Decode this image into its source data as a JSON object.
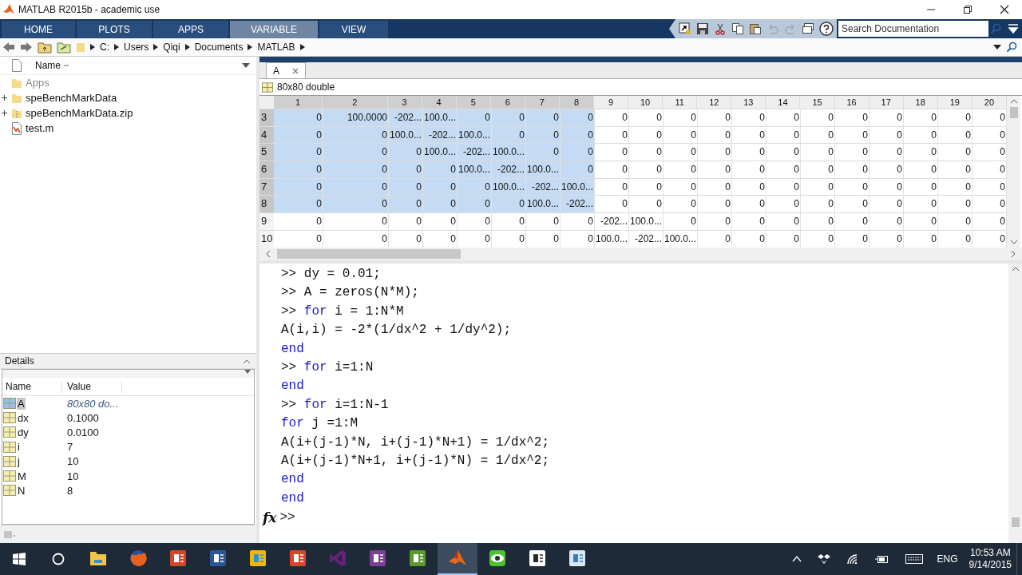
{
  "window": {
    "title": "MATLAB R2015b - academic use"
  },
  "ribbon": {
    "tabs": [
      {
        "label": "HOME",
        "selected": false
      },
      {
        "label": "PLOTS",
        "selected": false
      },
      {
        "label": "APPS",
        "selected": false
      },
      {
        "label": "VARIABLE",
        "selected": true
      },
      {
        "label": "VIEW",
        "selected": false
      }
    ],
    "search": {
      "placeholder": "Search Documentation"
    }
  },
  "address_bar": {
    "path": [
      "C:",
      "Users",
      "Qiqi",
      "Documents",
      "MATLAB"
    ]
  },
  "current_folder": {
    "header": "Name",
    "items": [
      {
        "name": "Apps",
        "kind": "folder",
        "expandable": false,
        "dimmed": true
      },
      {
        "name": "speBenchMarkData",
        "kind": "folder",
        "expandable": true,
        "dimmed": false
      },
      {
        "name": "speBenchMarkData.zip",
        "kind": "zip",
        "expandable": true,
        "dimmed": false
      },
      {
        "name": "test.m",
        "kind": "mfile",
        "expandable": false,
        "dimmed": false
      }
    ]
  },
  "details": {
    "title": "Details"
  },
  "workspace": {
    "columns": [
      "Name",
      "Value"
    ],
    "rows": [
      {
        "name": "A",
        "value": "80x80 do...",
        "kind": "matrix",
        "selected": true
      },
      {
        "name": "dx",
        "value": "0.1000",
        "kind": "scalar",
        "selected": false
      },
      {
        "name": "dy",
        "value": "0.0100",
        "kind": "scalar",
        "selected": false
      },
      {
        "name": "i",
        "value": "7",
        "kind": "scalar",
        "selected": false
      },
      {
        "name": "j",
        "value": "10",
        "kind": "scalar",
        "selected": false
      },
      {
        "name": "M",
        "value": "10",
        "kind": "scalar",
        "selected": false
      },
      {
        "name": "N",
        "value": "8",
        "kind": "scalar",
        "selected": false
      }
    ]
  },
  "variable_editor": {
    "tab": "A",
    "info": "80x80 double",
    "columns": [
      {
        "label": "1",
        "selected": true
      },
      {
        "label": "2",
        "selected": true
      },
      {
        "label": "3",
        "selected": true
      },
      {
        "label": "4",
        "selected": true
      },
      {
        "label": "5",
        "selected": true
      },
      {
        "label": "6",
        "selected": true
      },
      {
        "label": "7",
        "selected": true
      },
      {
        "label": "8",
        "selected": true
      },
      {
        "label": "9",
        "selected": false
      },
      {
        "label": "10",
        "selected": false
      },
      {
        "label": "11",
        "selected": false
      },
      {
        "label": "12",
        "selected": false
      },
      {
        "label": "13",
        "selected": false
      },
      {
        "label": "14",
        "selected": false
      },
      {
        "label": "15",
        "selected": false
      },
      {
        "label": "16",
        "selected": false
      },
      {
        "label": "17",
        "selected": false
      },
      {
        "label": "18",
        "selected": false
      },
      {
        "label": "19",
        "selected": false
      },
      {
        "label": "20",
        "selected": false
      }
    ],
    "rows": [
      {
        "label": "3",
        "selected": true,
        "cells": [
          "0",
          "100.0000",
          "-202...",
          "100.0...",
          "0",
          "0",
          "0",
          "0",
          "0",
          "0",
          "0",
          "0",
          "0",
          "0",
          "0",
          "0",
          "0",
          "0",
          "0",
          "0"
        ]
      },
      {
        "label": "4",
        "selected": true,
        "cells": [
          "0",
          "0",
          "100.0...",
          "-202...",
          "100.0...",
          "0",
          "0",
          "0",
          "0",
          "0",
          "0",
          "0",
          "0",
          "0",
          "0",
          "0",
          "0",
          "0",
          "0",
          "0"
        ]
      },
      {
        "label": "5",
        "selected": true,
        "cells": [
          "0",
          "0",
          "0",
          "100.0...",
          "-202...",
          "100.0...",
          "0",
          "0",
          "0",
          "0",
          "0",
          "0",
          "0",
          "0",
          "0",
          "0",
          "0",
          "0",
          "0",
          "0"
        ]
      },
      {
        "label": "6",
        "selected": true,
        "cells": [
          "0",
          "0",
          "0",
          "0",
          "100.0...",
          "-202...",
          "100.0...",
          "0",
          "0",
          "0",
          "0",
          "0",
          "0",
          "0",
          "0",
          "0",
          "0",
          "0",
          "0",
          "0"
        ]
      },
      {
        "label": "7",
        "selected": true,
        "cells": [
          "0",
          "0",
          "0",
          "0",
          "0",
          "100.0...",
          "-202...",
          "100.0...",
          "0",
          "0",
          "0",
          "0",
          "0",
          "0",
          "0",
          "0",
          "0",
          "0",
          "0",
          "0"
        ]
      },
      {
        "label": "8",
        "selected": true,
        "cells": [
          "0",
          "0",
          "0",
          "0",
          "0",
          "0",
          "100.0...",
          "-202...",
          "0",
          "0",
          "0",
          "0",
          "0",
          "0",
          "0",
          "0",
          "0",
          "0",
          "0",
          "0"
        ]
      },
      {
        "label": "9",
        "selected": false,
        "cells": [
          "0",
          "0",
          "0",
          "0",
          "0",
          "0",
          "0",
          "0",
          "-202...",
          "100.0...",
          "0",
          "0",
          "0",
          "0",
          "0",
          "0",
          "0",
          "0",
          "0",
          "0"
        ]
      },
      {
        "label": "10",
        "selected": false,
        "cells": [
          "0",
          "0",
          "0",
          "0",
          "0",
          "0",
          "0",
          "0",
          "100.0...",
          "-202...",
          "100.0...",
          "0",
          "0",
          "0",
          "0",
          "0",
          "0",
          "0",
          "0",
          "0"
        ]
      }
    ]
  },
  "command_window": {
    "lines": [
      [
        {
          "text": ">> dy = 0.01;",
          "kind": "code"
        }
      ],
      [
        {
          "text": ">> A = zeros(N*M);",
          "kind": "code"
        }
      ],
      [
        {
          "text": ">> ",
          "kind": "code"
        },
        {
          "text": "for",
          "kind": "keyword"
        },
        {
          "text": " i = 1:N*M",
          "kind": "code"
        }
      ],
      [
        {
          "text": "A(i,i) = -2*(1/dx^2 + 1/dy^2);",
          "kind": "code"
        }
      ],
      [
        {
          "text": "end",
          "kind": "keyword"
        }
      ],
      [
        {
          "text": ">> ",
          "kind": "code"
        },
        {
          "text": "for",
          "kind": "keyword"
        },
        {
          "text": " i=1:N",
          "kind": "code"
        }
      ],
      [
        {
          "text": "end",
          "kind": "keyword"
        }
      ],
      [
        {
          "text": ">> ",
          "kind": "code"
        },
        {
          "text": "for",
          "kind": "keyword"
        },
        {
          "text": " i=1:N-1",
          "kind": "code"
        }
      ],
      [
        {
          "text": "for",
          "kind": "keyword"
        },
        {
          "text": " j =1:M",
          "kind": "code"
        }
      ],
      [
        {
          "text": "A(i+(j-1)*N, i+(j-1)*N+1) = 1/dx^2;",
          "kind": "code"
        }
      ],
      [
        {
          "text": "A(i+(j-1)*N+1, i+(j-1)*N) = 1/dx^2;",
          "kind": "code"
        }
      ],
      [
        {
          "text": "end",
          "kind": "keyword"
        }
      ],
      [
        {
          "text": "end",
          "kind": "keyword"
        }
      ]
    ],
    "fx_label": "fx",
    "prompt": ">>"
  },
  "taskbar": {
    "apps": [
      {
        "kind": "explorer",
        "selected": false
      },
      {
        "kind": "firefox",
        "selected": false
      },
      {
        "kind": "powerpoint",
        "selected": false
      },
      {
        "kind": "word",
        "selected": false
      },
      {
        "kind": "tile_yellow",
        "selected": false
      },
      {
        "kind": "acrobat",
        "selected": false
      },
      {
        "kind": "visual_studio",
        "selected": false
      },
      {
        "kind": "onenote",
        "selected": false
      },
      {
        "kind": "camtasia",
        "selected": false
      },
      {
        "kind": "matlab",
        "selected": true
      },
      {
        "kind": "eye",
        "selected": false
      },
      {
        "kind": "camtasia_white",
        "selected": false
      },
      {
        "kind": "notepad",
        "selected": false
      }
    ],
    "language": "ENG",
    "time": "10:53 AM",
    "date": "9/14/2015"
  }
}
